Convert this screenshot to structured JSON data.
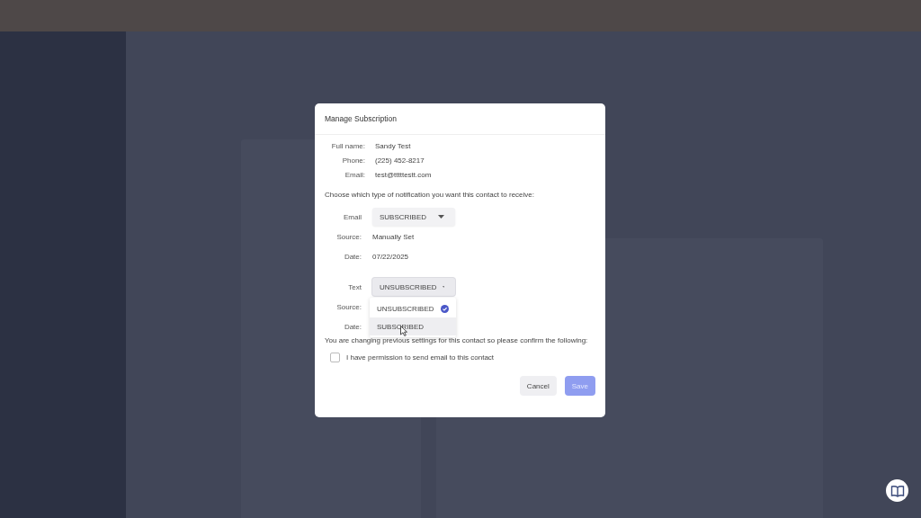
{
  "dialog": {
    "title": "Manage Subscription",
    "contact": [
      {
        "label": "Full name:",
        "value": "Sandy Test"
      },
      {
        "label": "Phone:",
        "value": "(225) 452-8217"
      },
      {
        "label": "Email:",
        "value": "test@tttttestt.com"
      }
    ],
    "prompt": "Choose which type of notification you want this contact to receive:",
    "channels": [
      {
        "label": "Email",
        "status": "SUBSCRIBED",
        "source_label": "Source:",
        "source": "Manually Set",
        "date_label": "Date:",
        "date": "07/22/2025",
        "expanded": false
      },
      {
        "label": "Text",
        "status": "UNSUBSCRIBED",
        "source_label": "Source:",
        "date_label": "Date:",
        "expanded": true,
        "options": [
          {
            "label": "UNSUBSCRIBED",
            "selected": true,
            "hovered": false
          },
          {
            "label": "SUBSCRIBED",
            "selected": false,
            "hovered": true
          }
        ]
      }
    ],
    "notice": "You are changing previous settings for this contact so please confirm the following:",
    "permission": {
      "label": "I have permission to send email to this contact",
      "checked": false
    },
    "buttons": [
      {
        "label": "Cancel",
        "kind": "secondary",
        "disabled": false
      },
      {
        "label": "Save",
        "kind": "primary",
        "disabled": true
      }
    ]
  }
}
